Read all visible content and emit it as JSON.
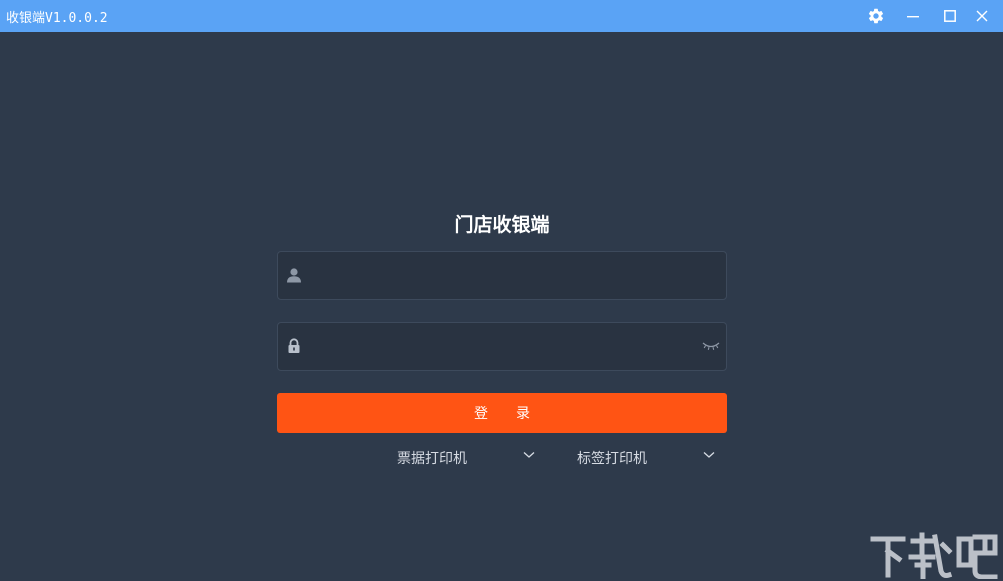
{
  "window": {
    "title": "收银端V1.0.0.2",
    "buttons": [
      "settings-gear-icon",
      "minimize-icon",
      "maximize-icon",
      "close-icon"
    ]
  },
  "login": {
    "title": "门店收银端",
    "username": {
      "value": "",
      "placeholder": "",
      "icon": "user-icon"
    },
    "password": {
      "value": "",
      "placeholder": "",
      "icon": "lock-icon",
      "toggle_icon": "eye-closed-icon"
    },
    "submit_label": "登录",
    "receipt_printer": {
      "label": "票据打印机",
      "icon": "chevron-down-icon"
    },
    "label_printer": {
      "label": "标签打印机",
      "icon": "chevron-down-icon"
    }
  },
  "colors": {
    "titlebar": "#5aa3f5",
    "background": "#2e3a4b",
    "input_bg": "#293341",
    "primary_button": "#ff5414"
  }
}
